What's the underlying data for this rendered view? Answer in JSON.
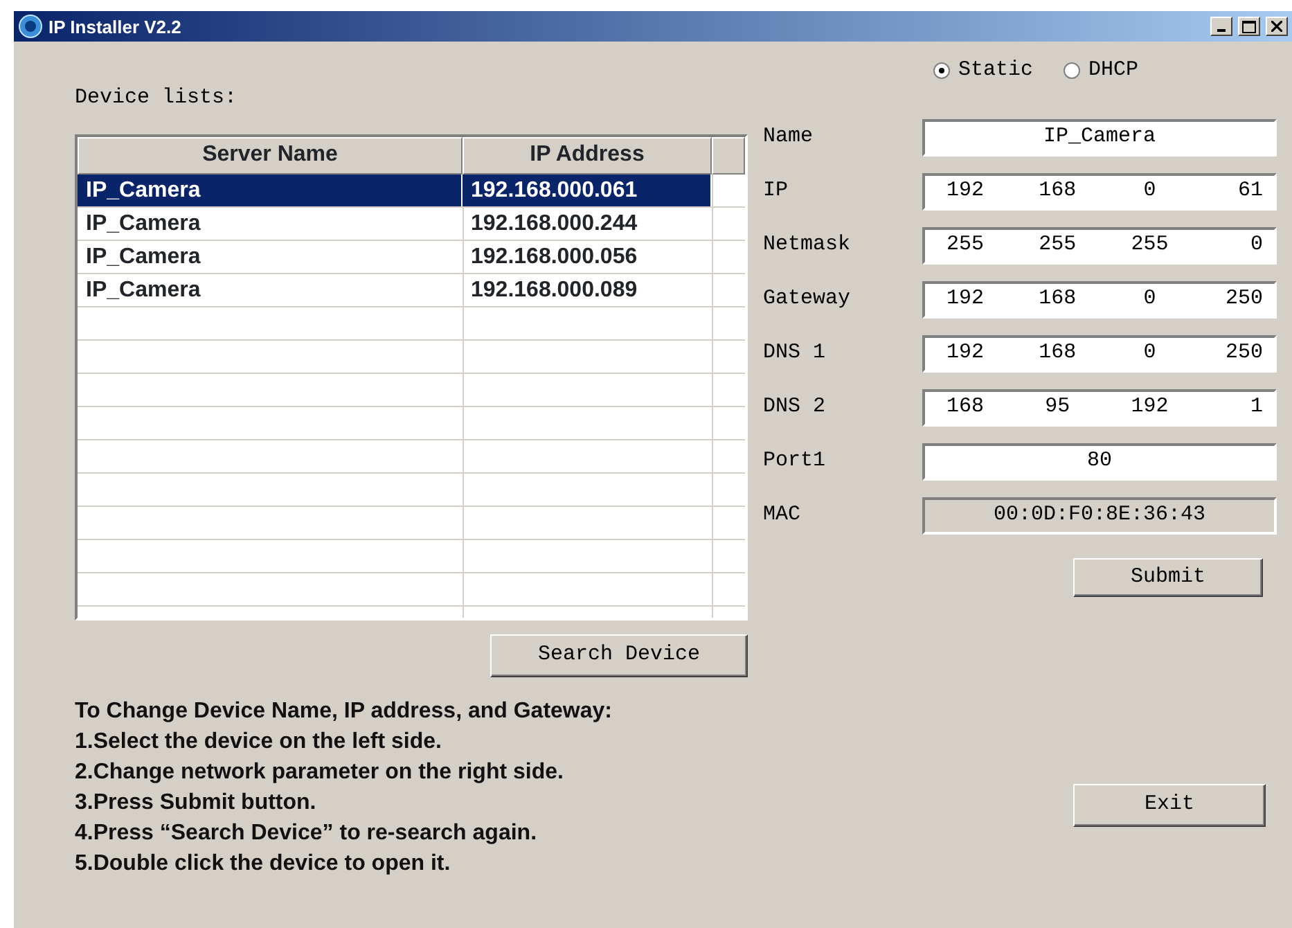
{
  "window": {
    "title": "IP Installer V2.2"
  },
  "device_list": {
    "label": "Device lists:",
    "columns": [
      "Server Name",
      "IP Address"
    ],
    "rows": [
      {
        "name": "IP_Camera",
        "ip": "192.168.000.061",
        "selected": true
      },
      {
        "name": "IP_Camera",
        "ip": "192.168.000.244",
        "selected": false
      },
      {
        "name": "IP_Camera",
        "ip": "192.168.000.056",
        "selected": false
      },
      {
        "name": "IP_Camera",
        "ip": "192.168.000.089",
        "selected": false
      }
    ]
  },
  "search_button": "Search Device",
  "instructions": [
    "To Change Device Name, IP address, and Gateway:",
    "1.Select the device on the left side.",
    "2.Change network parameter on the right side.",
    "3.Press Submit button.",
    "4.Press “Search Device” to re-search again.",
    "5.Double click the device to open it."
  ],
  "mode": [
    {
      "label": "Static",
      "selected": true
    },
    {
      "label": "DHCP",
      "selected": false
    }
  ],
  "fields": [
    {
      "label": "Name",
      "kind": "text",
      "value": "IP_Camera"
    },
    {
      "label": "IP",
      "kind": "ip",
      "octets": [
        "192",
        "168",
        "0",
        "61"
      ]
    },
    {
      "label": "Netmask",
      "kind": "ip",
      "octets": [
        "255",
        "255",
        "255",
        "0"
      ]
    },
    {
      "label": "Gateway",
      "kind": "ip",
      "octets": [
        "192",
        "168",
        "0",
        "250"
      ]
    },
    {
      "label": "DNS 1",
      "kind": "ip",
      "octets": [
        "192",
        "168",
        "0",
        "250"
      ]
    },
    {
      "label": "DNS 2",
      "kind": "ip",
      "octets": [
        "168",
        "95",
        "192",
        "1"
      ]
    },
    {
      "label": "Port1",
      "kind": "text",
      "value": "80"
    },
    {
      "label": "MAC",
      "kind": "readonly",
      "value": "00:0D:F0:8E:36:43"
    }
  ],
  "submit_button": "Submit",
  "exit_button": "Exit"
}
